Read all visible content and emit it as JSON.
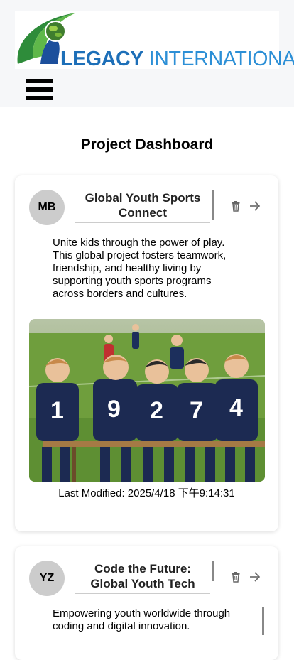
{
  "header": {
    "logo": {
      "brand_bold": "LEGACY",
      "brand_light": "INTERNATIONAL"
    },
    "menu_icon": "hamburger-menu-icon"
  },
  "page": {
    "title": "Project Dashboard"
  },
  "projects": [
    {
      "initials": "MB",
      "title": "Global Youth Sports Connect",
      "description": "Unite kids through the power of play. This global project fosters teamwork, friendship, and healthy living by supporting youth sports programs across borders and cultures.",
      "image": "youth-soccer-team-photo",
      "last_modified": "Last Modified: 2025/4/18 下午9:14:31",
      "actions": [
        "trash-icon",
        "arrow-right-icon"
      ]
    },
    {
      "initials": "YZ",
      "title": "Code the Future: Global Youth Tech",
      "description": "Empowering youth worldwide through coding and digital innovation.",
      "actions": [
        "trash-icon",
        "arrow-right-icon"
      ]
    }
  ],
  "colors": {
    "header_bg": "#f6f7f9",
    "brand_blue": "#1d6fb8",
    "brand_green": "#3a9a3a",
    "avatar_bg": "#cccccc"
  }
}
